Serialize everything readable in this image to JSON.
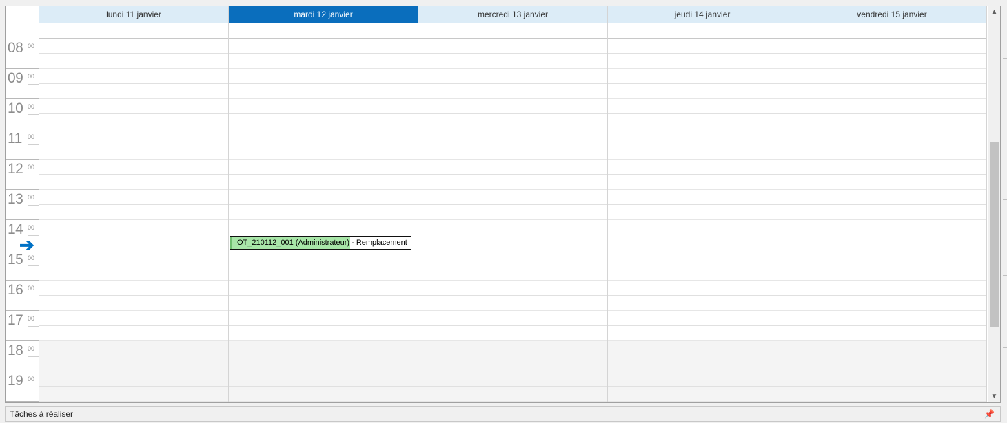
{
  "days": [
    {
      "label": "lundi 11 janvier",
      "today": false
    },
    {
      "label": "mardi 12 janvier",
      "today": true
    },
    {
      "label": "mercredi 13 janvier",
      "today": false
    },
    {
      "label": "jeudi 14 janvier",
      "today": false
    },
    {
      "label": "vendredi 15 janvier",
      "today": false
    }
  ],
  "hours": [
    "08",
    "09",
    "10",
    "11",
    "12",
    "13",
    "14",
    "15",
    "16",
    "17",
    "18",
    "19"
  ],
  "minutes_label": "00",
  "event": {
    "title": "OT_210112_001 (Administrateur) - Remplacement",
    "day": "mardi 12 janvier",
    "color": "#a8e6a8"
  },
  "scrollbar": {
    "up": "▲",
    "down": "▼"
  },
  "tasks_panel": {
    "label": "Tâches à réaliser",
    "pin_icon": "pin-icon"
  },
  "colors": {
    "today_header": "#0a6ebd",
    "header_bg": "#dcecf7",
    "now_arrow": "#0071c5"
  }
}
